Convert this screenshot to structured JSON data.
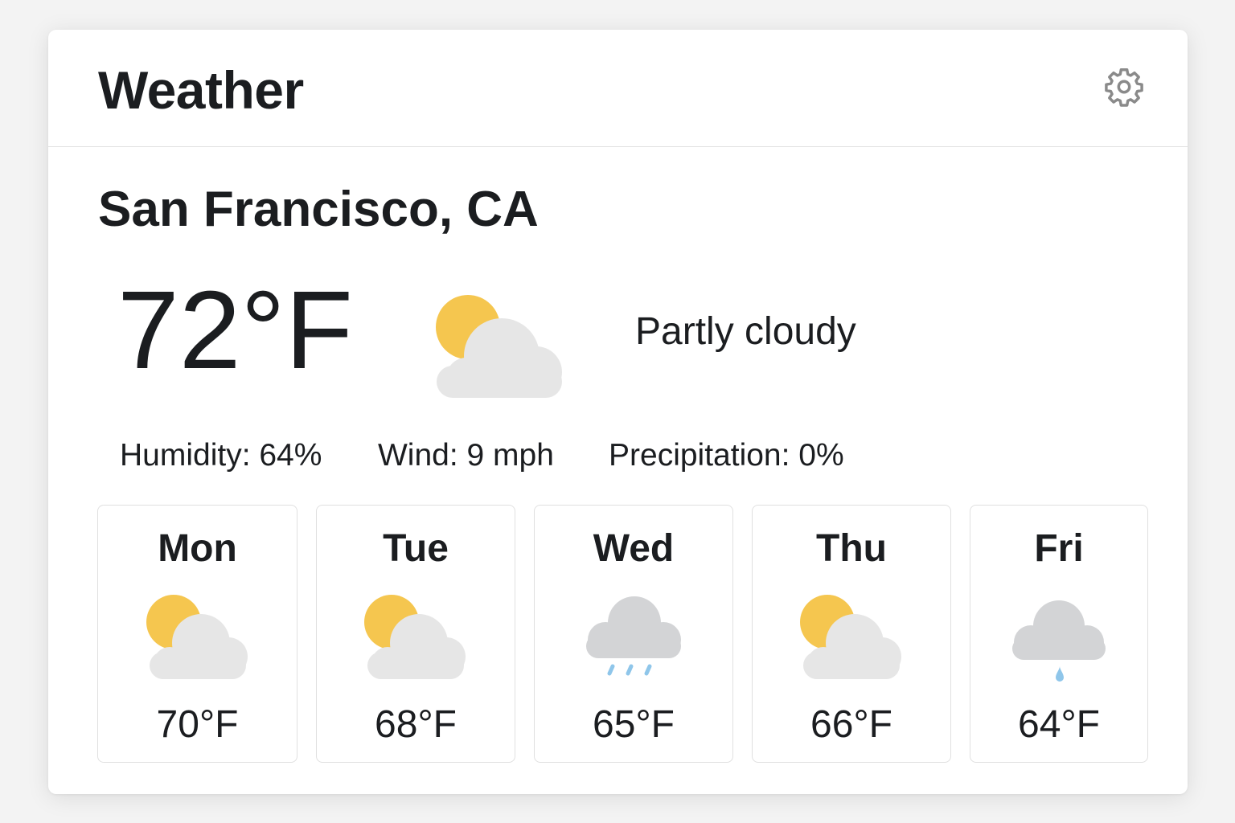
{
  "header": {
    "title": "Weather",
    "settings_icon": "gear-icon"
  },
  "current": {
    "location": "San Francisco, CA",
    "temperature": "72°F",
    "condition": "Partly cloudy",
    "icon": "partly-cloudy-icon",
    "humidity": "Humidity: 64%",
    "wind": "Wind: 9 mph",
    "precipitation": "Precipitation: 0%"
  },
  "forecast": [
    {
      "day": "Mon",
      "temp": "70°F",
      "icon": "partly-cloudy-icon"
    },
    {
      "day": "Tue",
      "temp": "68°F",
      "icon": "partly-cloudy-icon"
    },
    {
      "day": "Wed",
      "temp": "65°F",
      "icon": "rain-icon"
    },
    {
      "day": "Thu",
      "temp": "66°F",
      "icon": "partly-cloudy-icon"
    },
    {
      "day": "Fri",
      "temp": "64°F",
      "icon": "drizzle-icon"
    }
  ],
  "colors": {
    "sun": "#f5c64f",
    "cloud_light": "#e6e6e6",
    "cloud_gray": "#d3d4d6",
    "rain": "#8fc6ea",
    "gear": "#8a8a8a"
  }
}
